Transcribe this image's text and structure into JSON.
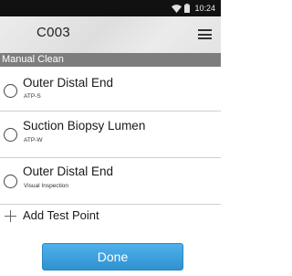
{
  "status_bar": {
    "time": "10:24",
    "icons": [
      "wifi-icon",
      "battery-icon"
    ]
  },
  "header": {
    "title": "C003",
    "menu_icon": "hamburger-menu-icon"
  },
  "section": {
    "label": "Manual Clean"
  },
  "test_points": [
    {
      "title": "Outer Distal End",
      "subtitle": "ATP-S"
    },
    {
      "title": "Suction Biopsy Lumen",
      "subtitle": "ATP-W"
    },
    {
      "title": "Outer Distal End",
      "subtitle": "Visual Inspection"
    }
  ],
  "add_test_point": {
    "label": "Add Test Point",
    "icon": "plus-icon"
  },
  "done_button": {
    "label": "Done"
  },
  "colors": {
    "status_bar": "#111111",
    "section_bar": "#7d7d7d",
    "accent": "#3a9fdc"
  }
}
